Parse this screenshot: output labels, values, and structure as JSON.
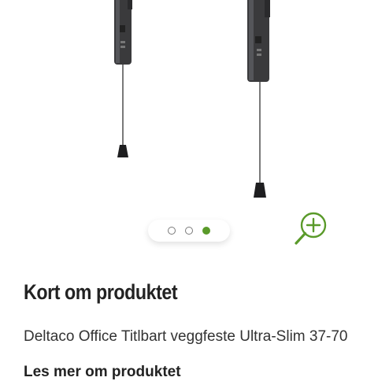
{
  "gallery": {
    "image_icon": "tv-wall-mount-image",
    "dots": [
      {
        "state": "inactive"
      },
      {
        "state": "inactive"
      },
      {
        "state": "active"
      }
    ],
    "active_index": 2,
    "accent_color": "#5a9a2a",
    "zoom_icon": "zoom-in-icon"
  },
  "summary": {
    "title": "Kort om produktet",
    "product_name": "Deltaco Office Titlbart veggfeste Ultra-Slim 37-70",
    "read_more_label": "Les mer om produktet"
  }
}
